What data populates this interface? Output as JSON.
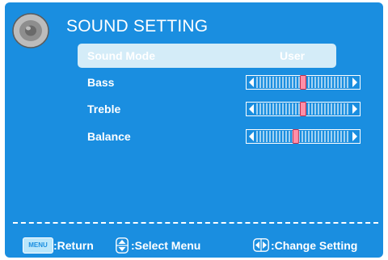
{
  "header": {
    "title": "SOUND SETTING"
  },
  "menu": {
    "items": [
      {
        "label": "Sound Mode",
        "value": "User",
        "selected": true
      },
      {
        "label": "Bass",
        "level": 0.5
      },
      {
        "label": "Treble",
        "level": 0.5
      },
      {
        "label": "Balance",
        "level": 0.42
      }
    ]
  },
  "footer": {
    "menu_key": "MENU",
    "return_label": ":Return",
    "select_label": ":Select Menu",
    "change_label": ":Change Setting"
  },
  "colors": {
    "panel": "#1a8ee0",
    "selected_row": "#d4ecf8",
    "slider_knob": "#ff8fa8",
    "text": "#ffffff"
  }
}
